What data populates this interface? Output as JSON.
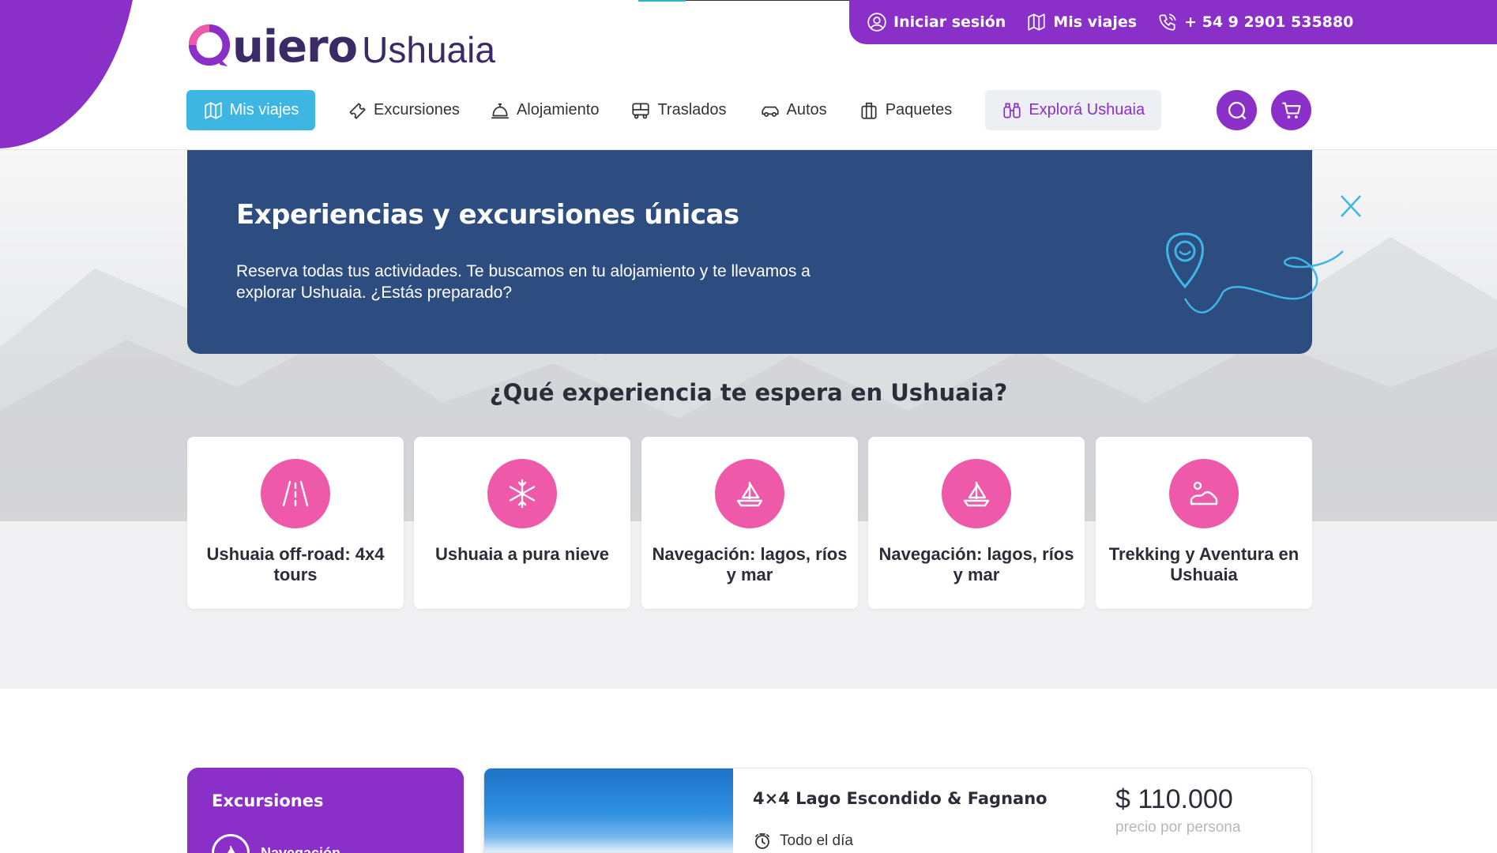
{
  "colors": {
    "brand_purple": "#8b2fc9",
    "accent_blue": "#3eb6e4",
    "banner_navy": "#2d4c80",
    "card_pink": "#ee5aa9",
    "text_dark": "#2d2d3a"
  },
  "topbar": {
    "login_label": "Iniciar sesión",
    "login_icon": "user-circle-icon",
    "trips_label": "Mis viajes",
    "trips_icon": "map-icon",
    "phone_label": "+ 54 9 2901 535880",
    "phone_icon": "phone-icon"
  },
  "logo": {
    "word1": "uiero",
    "word2": "Ushuaia"
  },
  "nav": {
    "items": [
      {
        "label": "Mis viajes",
        "icon": "map-icon"
      },
      {
        "label": "Excursiones",
        "icon": "ticket-icon"
      },
      {
        "label": "Alojamiento",
        "icon": "bell-icon"
      },
      {
        "label": "Traslados",
        "icon": "bus-icon"
      },
      {
        "label": "Autos",
        "icon": "car-icon"
      },
      {
        "label": "Paquetes",
        "icon": "luggage-icon"
      }
    ],
    "explore_label": "Explorá Ushuaia",
    "explore_icon": "binoculars-icon",
    "search_icon": "search-icon",
    "cart_icon": "cart-icon"
  },
  "banner": {
    "title": "Experiencias y excursiones únicas",
    "text": "Reserva todas tus actividades. Te buscamos en tu alojamiento y te llevamos a explorar Ushuaia. ¿Estás preparado?"
  },
  "experiences": {
    "heading": "¿Qué experiencia te espera en Ushuaia?",
    "cards": [
      {
        "label": "Ushuaia off-road: 4x4 tours",
        "icon": "road-icon"
      },
      {
        "label": "Ushuaia a pura nieve",
        "icon": "snowflake-icon"
      },
      {
        "label": "Navegación: lagos, ríos y mar",
        "icon": "sailboat-icon"
      },
      {
        "label": "Navegación: lagos, ríos y mar",
        "icon": "sailboat-icon"
      },
      {
        "label": "Trekking y Aventura en Ushuaia",
        "icon": "landscape-icon"
      }
    ],
    "prev_icon": "chevron-left-icon",
    "next_icon": "chevron-right-icon"
  },
  "filters": {
    "title": "Excursiones",
    "first_item": "Navegación"
  },
  "product": {
    "title": "4×4 Lago Escondido & Fagnano",
    "duration": "Todo el día",
    "duration_icon": "clock-icon",
    "price": "$ 110.000",
    "price_note": "precio por persona"
  }
}
